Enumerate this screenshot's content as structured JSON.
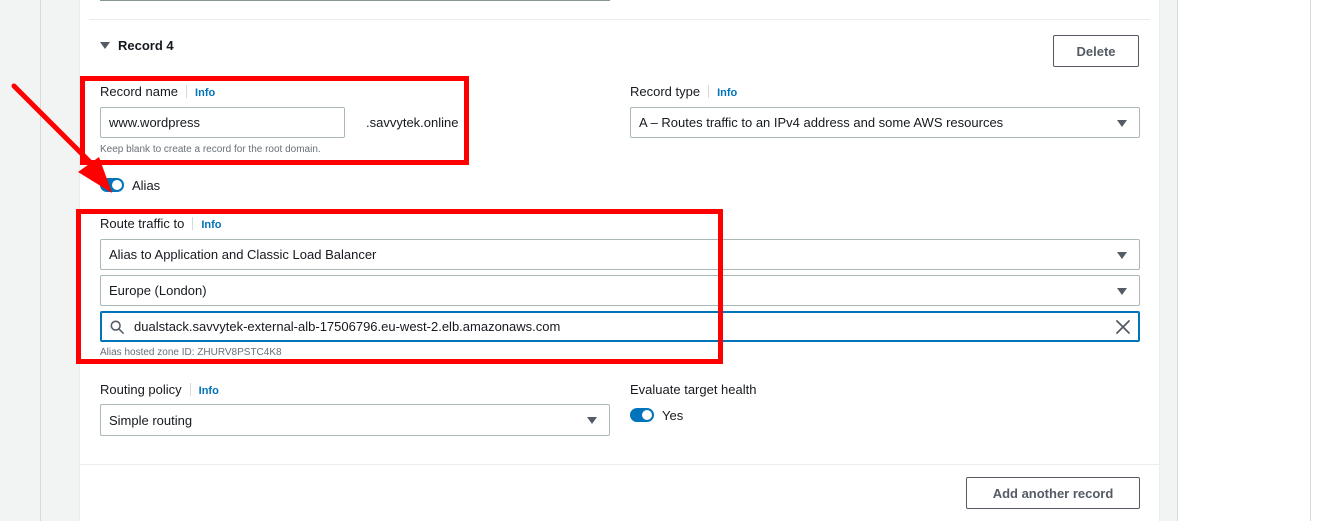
{
  "record": {
    "title": "Record 4",
    "delete_label": "Delete"
  },
  "record_name": {
    "label": "Record name",
    "info": "Info",
    "value": "www.wordpress",
    "suffix": ".savvytek.online",
    "hint": "Keep blank to create a record for the root domain."
  },
  "record_type": {
    "label": "Record type",
    "info": "Info",
    "value": "A – Routes traffic to an IPv4 address and some AWS resources"
  },
  "alias": {
    "label": "Alias",
    "enabled": true
  },
  "route_traffic": {
    "label": "Route traffic to",
    "info": "Info",
    "endpoint_type": "Alias to Application and Classic Load Balancer",
    "region": "Europe (London)",
    "load_balancer": "dualstack.savvytek-external-alb-17506796.eu-west-2.elb.amazonaws.com",
    "hosted_zone_hint": "Alias hosted zone ID: ZHURV8PSTC4K8"
  },
  "routing_policy": {
    "label": "Routing policy",
    "info": "Info",
    "value": "Simple routing"
  },
  "evaluate_health": {
    "label": "Evaluate target health",
    "toggle_label": "Yes",
    "enabled": true
  },
  "footer": {
    "add_label": "Add another record"
  },
  "colors": {
    "accent": "#0073bb",
    "annotation": "#ff0000"
  }
}
